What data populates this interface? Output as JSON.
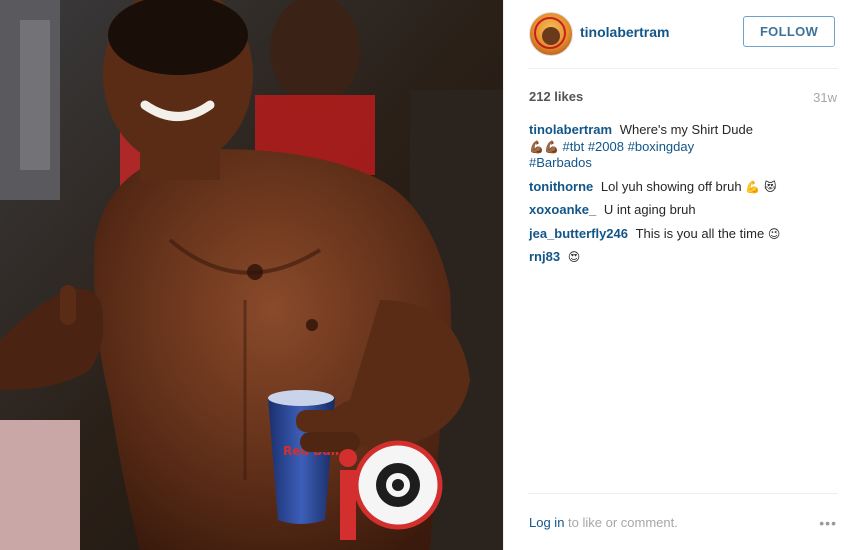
{
  "header": {
    "username": "tinolabertram",
    "follow_label": "FOLLOW"
  },
  "stats": {
    "likes": "212 likes",
    "time": "31w"
  },
  "caption": {
    "user": "tinolabertram",
    "text": "Where's my Shirt Dude",
    "emoji": "💪🏾💪🏾",
    "tags": [
      "#tbt",
      "#2008",
      "#boxingday",
      "#Barbados"
    ]
  },
  "comments": [
    {
      "user": "tonithorne",
      "text": "Lol yuh showing off bruh",
      "emoji": "💪 😻"
    },
    {
      "user": "xoxoanke_",
      "text": "U int aging bruh",
      "emoji": ""
    },
    {
      "user": "jea_butterfly246",
      "text": "This is you all the time",
      "emoji": "😉"
    },
    {
      "user": "rnj83",
      "text": "",
      "emoji": "😍"
    }
  ],
  "footer": {
    "login_text": "Log in",
    "rest_text": " to like or comment.",
    "more_icon": "•••"
  },
  "photo": {
    "watermark": "ib",
    "cup_text": "Red Bull"
  },
  "colors": {
    "link_blue": "#125688",
    "follow_blue": "#3f729b",
    "muted_gray": "#a5a7aa"
  }
}
